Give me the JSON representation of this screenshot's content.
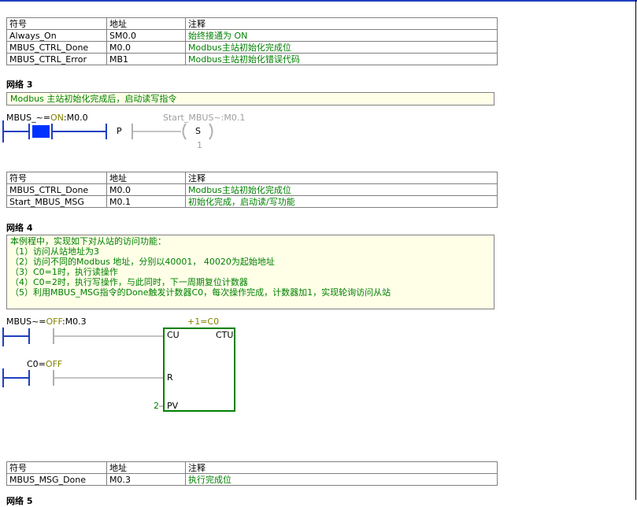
{
  "table_headers": {
    "symbol": "符号",
    "address": "地址",
    "comment": "注释"
  },
  "table1": [
    {
      "symbol": "Always_On",
      "address": "SM0.0",
      "comment": "始终接通为 ON"
    },
    {
      "symbol": "MBUS_CTRL_Done",
      "address": "M0.0",
      "comment": "Modbus主站初始化完成位"
    },
    {
      "symbol": "MBUS_CTRL_Error",
      "address": "MB1",
      "comment": "Modbus主站初始化错误代码"
    }
  ],
  "network3": {
    "title": "网络 3",
    "comment": "Modbus 主站初始化完成后，启动读写指令",
    "contact_name": "MBUS_~",
    "contact_eq": "=",
    "contact_state": "ON",
    "contact_addr": ":M0.0",
    "p_label": "P",
    "coil_name": "Start_MBUS~:M0.1",
    "coil_label": "S",
    "coil_count": "1"
  },
  "table2": [
    {
      "symbol": "MBUS_CTRL_Done",
      "address": "M0.0",
      "comment": "Modbus主站初始化完成位"
    },
    {
      "symbol": "Start_MBUS_MSG",
      "address": "M0.1",
      "comment": "初始化完成，启动读/写功能"
    }
  ],
  "network4": {
    "title": "网络 4",
    "comment_lines": [
      "本例程中，实现如下对从站的访问功能：",
      "（1）访问从站地址为3",
      "（2）访问不同的Modbus 地址，分别以40001， 40020为起始地址",
      "（3）C0=1时，执行读操作",
      "（4）C0=2时，执行写操作，与此同时，下一周期复位计数器",
      "（5）利用MBUS_MSG指令的Done触发计数器C0，每次操作完成，计数器加1，实现轮询访问从站"
    ],
    "contact1_name": "MBUS~",
    "contact1_eq": "=",
    "contact1_state": "OFF",
    "contact1_addr": ":M0.3",
    "contact2_name": "C0",
    "contact2_eq": "=",
    "contact2_state": "OFF",
    "counter_top": "+1=C0",
    "counter_cu": "CU",
    "counter_type": "CTU",
    "counter_r": "R",
    "counter_pv_value": "2",
    "counter_pv": "PV"
  },
  "table3": [
    {
      "symbol": "MBUS_MSG_Done",
      "address": "M0.3",
      "comment": "执行完成位"
    }
  ],
  "network5": {
    "title": "网络 5"
  },
  "colors": {
    "rail": "#1f3fbf",
    "energized": "#0033ff",
    "box": "#008000",
    "unpowered": "#b0b0b0"
  }
}
